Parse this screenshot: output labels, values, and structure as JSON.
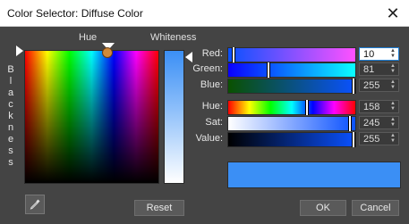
{
  "window": {
    "title": "Color Selector: Diffuse Color",
    "close_glyph": "✕"
  },
  "picker": {
    "hue_label": "Hue",
    "whiteness_label": "Whiteness",
    "blackness_letters": [
      "B",
      "l",
      "a",
      "c",
      "k",
      "n",
      "e",
      "s",
      "s"
    ]
  },
  "sliders": [
    {
      "label": "Red:",
      "value": "10",
      "fraction": 0.04
    },
    {
      "label": "Green:",
      "value": "81",
      "fraction": 0.32
    },
    {
      "label": "Blue:",
      "value": "255",
      "fraction": 1.0
    },
    {
      "label": "Hue:",
      "value": "158",
      "fraction": 0.62
    },
    {
      "label": "Sat:",
      "value": "245",
      "fraction": 0.96
    },
    {
      "label": "Value:",
      "value": "255",
      "fraction": 1.0
    }
  ],
  "preview_color": "#3b8ff5",
  "buttons": {
    "reset": "Reset",
    "ok": "OK",
    "cancel": "Cancel"
  },
  "icons": {
    "eyedropper": "eyedropper-icon"
  }
}
